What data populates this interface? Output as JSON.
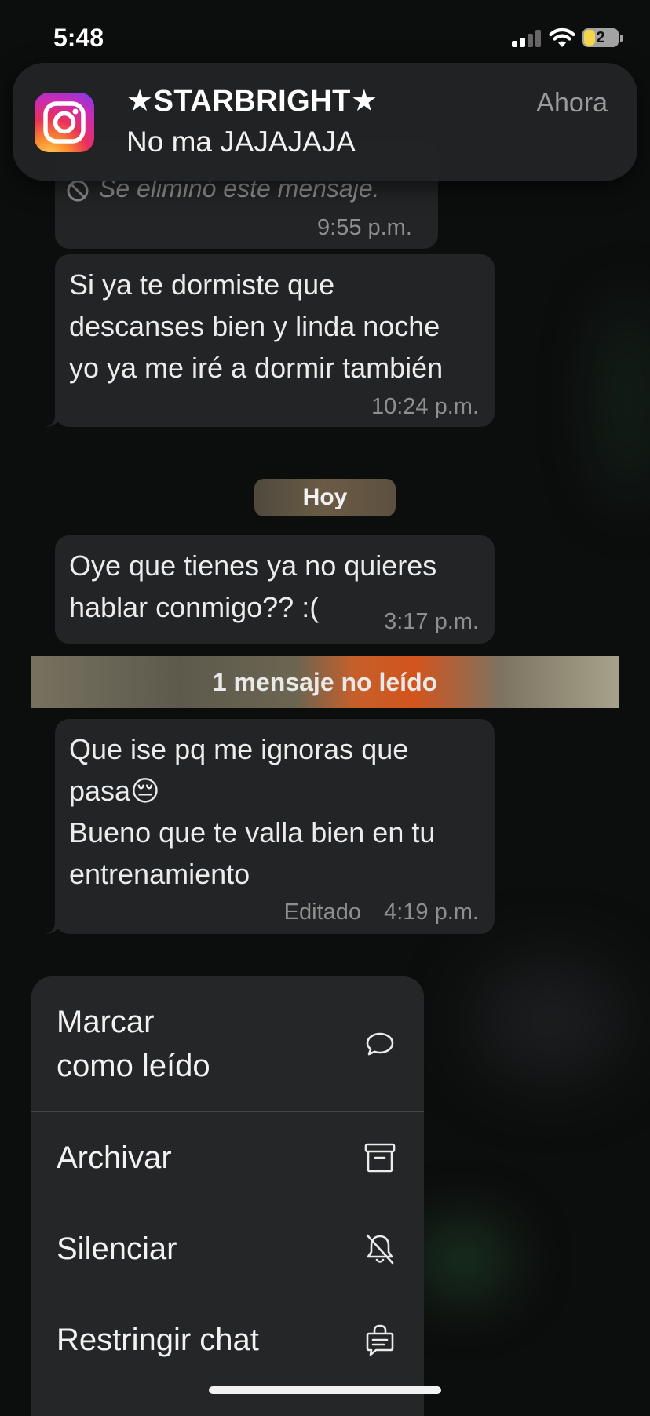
{
  "status_bar": {
    "time": "5:48",
    "battery": "2"
  },
  "notification": {
    "app_icon": "instagram-icon",
    "title": "★STARBRIGHT★",
    "message": "No ma JAJAJAJA",
    "time": "Ahora"
  },
  "chat": {
    "messages": [
      {
        "id": "deleted",
        "text": "Se eliminó este mensaje.",
        "time": "9:55 p.m.",
        "icon": "ban-icon"
      },
      {
        "id": "goodnight",
        "lines": [
          "Si ya te dormiste que",
          "descanses bien y linda noche",
          "yo ya me iré a dormir también"
        ],
        "time": "10:24 p.m."
      },
      {
        "id": "why",
        "lines": [
          "Oye que tienes ya no quieres",
          "hablar conmigo?? :("
        ],
        "time": "3:17 p.m."
      },
      {
        "id": "ignore",
        "lines": [
          "Que ise pq me ignoras que",
          "pasa😔",
          "Bueno que te valla bien en tu",
          "entrenamiento"
        ],
        "edited": "Editado",
        "time": "4:19 p.m."
      }
    ],
    "day_separator": "Hoy",
    "unread_banner": "1 mensaje no leído"
  },
  "context_menu": {
    "items": [
      {
        "lines": [
          "Marcar",
          "como leído"
        ],
        "icon": "chat-bubble-icon"
      },
      {
        "label": "Archivar",
        "icon": "archive-box-icon"
      },
      {
        "label": "Silenciar",
        "icon": "bell-slash-icon"
      },
      {
        "label": "Restringir chat",
        "icon": "lock-chat-icon"
      }
    ]
  }
}
